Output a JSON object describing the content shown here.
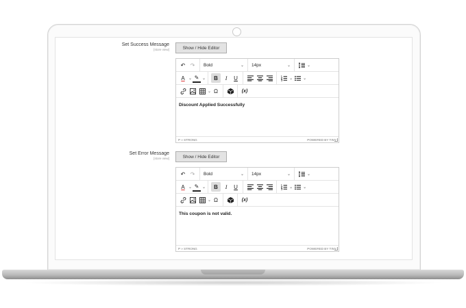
{
  "rows": [
    {
      "label": "Set Success Message",
      "scope": "[store view]",
      "toggle_label": "Show / Hide Editor",
      "block_format": "Bold",
      "font_size": "14px",
      "content": "Discount Applied Successfully",
      "path": "P » STRONG",
      "brand": "POWERED BY TINY"
    },
    {
      "label": "Set Error Message",
      "scope": "[store view]",
      "toggle_label": "Show / Hide Editor",
      "block_format": "Bold",
      "font_size": "14px",
      "content": "This coupon is not valid.",
      "path": "P » STRONG",
      "brand": "POWERED BY TINY"
    }
  ],
  "icons": {
    "undo": "↶",
    "redo": "↷",
    "line_height": "≡",
    "chevron": "⌄",
    "font_color": "A",
    "highlight": "✎",
    "bold": "B",
    "italic": "I",
    "underline": "U",
    "omega": "Ω",
    "variable": "(x)"
  }
}
